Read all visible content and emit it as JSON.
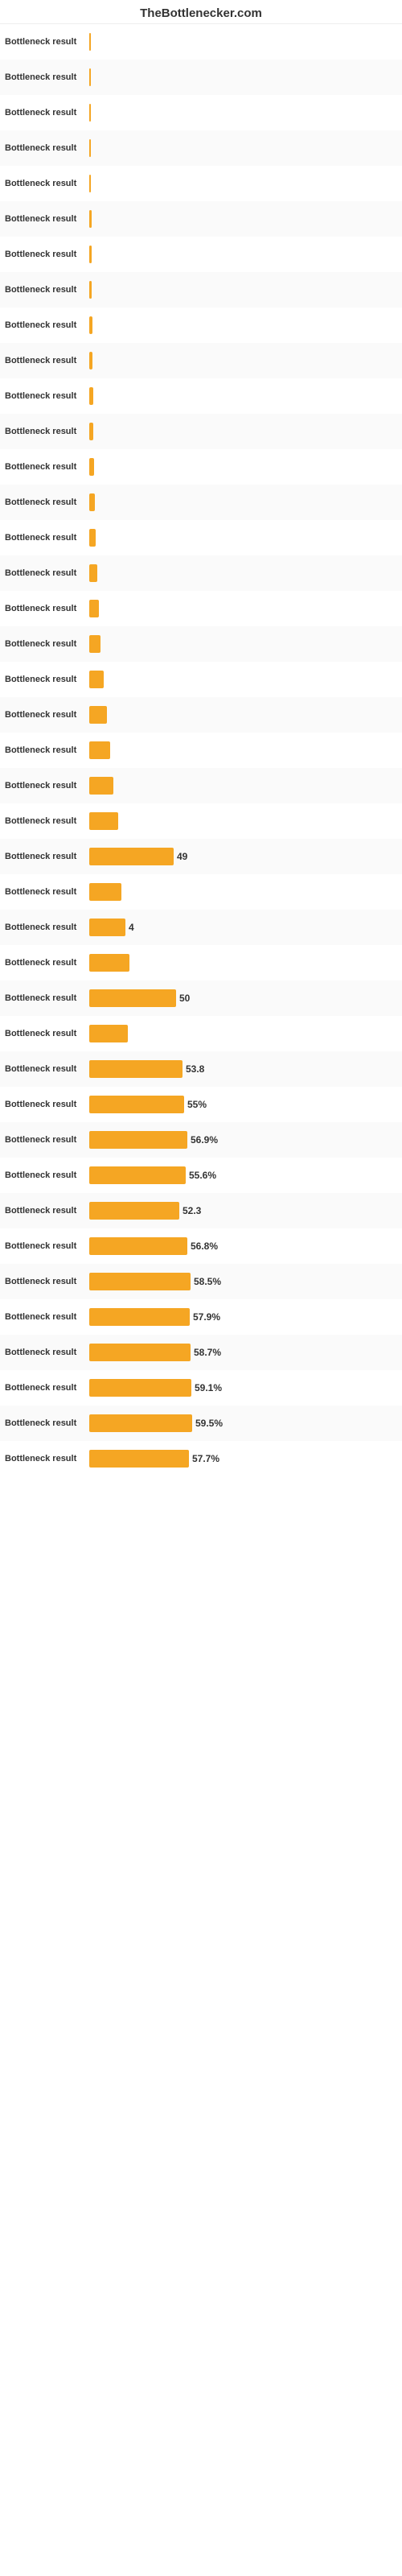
{
  "header": {
    "title": "TheBottlenecker.com"
  },
  "rows": [
    {
      "label": "Bottleneck result",
      "value": "",
      "barWidth": 2
    },
    {
      "label": "Bottleneck result",
      "value": "",
      "barWidth": 2
    },
    {
      "label": "Bottleneck result",
      "value": "",
      "barWidth": 2
    },
    {
      "label": "Bottleneck result",
      "value": "",
      "barWidth": 2
    },
    {
      "label": "Bottleneck result",
      "value": "",
      "barWidth": 2
    },
    {
      "label": "Bottleneck result",
      "value": "",
      "barWidth": 3
    },
    {
      "label": "Bottleneck result",
      "value": "",
      "barWidth": 3
    },
    {
      "label": "Bottleneck result",
      "value": "",
      "barWidth": 3
    },
    {
      "label": "Bottleneck result",
      "value": "",
      "barWidth": 4
    },
    {
      "label": "Bottleneck result",
      "value": "",
      "barWidth": 4
    },
    {
      "label": "Bottleneck result",
      "value": "",
      "barWidth": 5
    },
    {
      "label": "Bottleneck result",
      "value": "",
      "barWidth": 5
    },
    {
      "label": "Bottleneck result",
      "value": "",
      "barWidth": 6
    },
    {
      "label": "Bottleneck result",
      "value": "",
      "barWidth": 7
    },
    {
      "label": "Bottleneck result",
      "value": "",
      "barWidth": 8
    },
    {
      "label": "Bottleneck result",
      "value": "",
      "barWidth": 10
    },
    {
      "label": "Bottleneck result",
      "value": "",
      "barWidth": 12
    },
    {
      "label": "Bottleneck result",
      "value": "",
      "barWidth": 14
    },
    {
      "label": "Bottleneck result",
      "value": "",
      "barWidth": 18
    },
    {
      "label": "Bottleneck result",
      "value": "",
      "barWidth": 22
    },
    {
      "label": "Bottleneck result",
      "value": "",
      "barWidth": 26
    },
    {
      "label": "Bottleneck result",
      "value": "",
      "barWidth": 30
    },
    {
      "label": "Bottleneck result",
      "value": "",
      "barWidth": 36
    },
    {
      "label": "Bottleneck result",
      "value": "49",
      "barWidth": 105
    },
    {
      "label": "Bottleneck result",
      "value": "",
      "barWidth": 40
    },
    {
      "label": "Bottleneck result",
      "value": "4",
      "barWidth": 45
    },
    {
      "label": "Bottleneck result",
      "value": "",
      "barWidth": 50
    },
    {
      "label": "Bottleneck result",
      "value": "50",
      "barWidth": 108
    },
    {
      "label": "Bottleneck result",
      "value": "",
      "barWidth": 48
    },
    {
      "label": "Bottleneck result",
      "value": "53.8",
      "barWidth": 116
    },
    {
      "label": "Bottleneck result",
      "value": "55%",
      "barWidth": 118
    },
    {
      "label": "Bottleneck result",
      "value": "56.9%",
      "barWidth": 122
    },
    {
      "label": "Bottleneck result",
      "value": "55.6%",
      "barWidth": 120
    },
    {
      "label": "Bottleneck result",
      "value": "52.3",
      "barWidth": 112
    },
    {
      "label": "Bottleneck result",
      "value": "56.8%",
      "barWidth": 122
    },
    {
      "label": "Bottleneck result",
      "value": "58.5%",
      "barWidth": 126
    },
    {
      "label": "Bottleneck result",
      "value": "57.9%",
      "barWidth": 125
    },
    {
      "label": "Bottleneck result",
      "value": "58.7%",
      "barWidth": 126
    },
    {
      "label": "Bottleneck result",
      "value": "59.1%",
      "barWidth": 127
    },
    {
      "label": "Bottleneck result",
      "value": "59.5%",
      "barWidth": 128
    },
    {
      "label": "Bottleneck result",
      "value": "57.7%",
      "barWidth": 124
    }
  ]
}
